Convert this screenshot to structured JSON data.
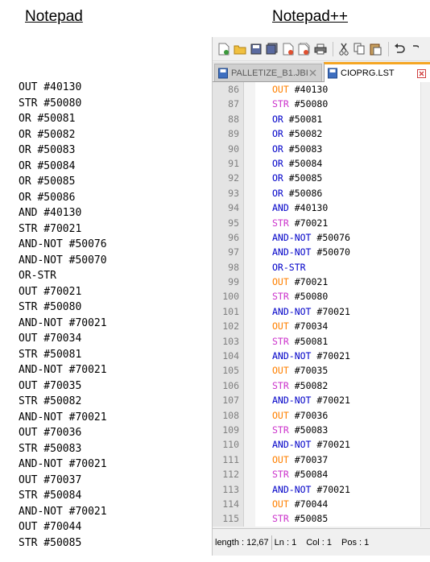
{
  "headings": {
    "notepad": "Notepad",
    "notepadpp": "Notepad++"
  },
  "notepad_lines": [
    "OUT #40130",
    "STR #50080",
    "OR #50081",
    "OR #50082",
    "OR #50083",
    "OR #50084",
    "OR #50085",
    "OR #50086",
    "AND #40130",
    "STR #70021",
    "AND-NOT #50076",
    "AND-NOT #50070",
    "OR-STR",
    "OUT #70021",
    "STR #50080",
    "AND-NOT #70021",
    "OUT #70034",
    "STR #50081",
    "AND-NOT #70021",
    "OUT #70035",
    "STR #50082",
    "AND-NOT #70021",
    "OUT #70036",
    "STR #50083",
    "AND-NOT #70021",
    "OUT #70037",
    "STR #50084",
    "AND-NOT #70021",
    "OUT #70044",
    "STR #50085"
  ],
  "tabs": [
    {
      "label": "PALLETIZE_B1.JBI",
      "active": false
    },
    {
      "label": "CIOPRG.LST",
      "active": true
    }
  ],
  "colors": {
    "OUT": "#ff8000",
    "STR": "#cc33cc",
    "OR": "#0000c8",
    "AND": "#0000c8",
    "AND-NOT": "#0000c8",
    "OR-STR": "#0000c8",
    "tab_accent": "#f5a623"
  },
  "editor_lines": [
    {
      "n": "86",
      "op": "OUT",
      "arg": "#40130"
    },
    {
      "n": "87",
      "op": "STR",
      "arg": "#50080"
    },
    {
      "n": "88",
      "op": "OR",
      "arg": "#50081"
    },
    {
      "n": "89",
      "op": "OR",
      "arg": "#50082"
    },
    {
      "n": "90",
      "op": "OR",
      "arg": "#50083"
    },
    {
      "n": "91",
      "op": "OR",
      "arg": "#50084"
    },
    {
      "n": "92",
      "op": "OR",
      "arg": "#50085"
    },
    {
      "n": "93",
      "op": "OR",
      "arg": "#50086"
    },
    {
      "n": "94",
      "op": "AND",
      "arg": "#40130"
    },
    {
      "n": "95",
      "op": "STR",
      "arg": "#70021"
    },
    {
      "n": "96",
      "op": "AND-NOT",
      "arg": "#50076"
    },
    {
      "n": "97",
      "op": "AND-NOT",
      "arg": "#50070"
    },
    {
      "n": "98",
      "op": "OR-STR",
      "arg": ""
    },
    {
      "n": "99",
      "op": "OUT",
      "arg": "#70021"
    },
    {
      "n": "100",
      "op": "STR",
      "arg": "#50080"
    },
    {
      "n": "101",
      "op": "AND-NOT",
      "arg": "#70021"
    },
    {
      "n": "102",
      "op": "OUT",
      "arg": "#70034"
    },
    {
      "n": "103",
      "op": "STR",
      "arg": "#50081"
    },
    {
      "n": "104",
      "op": "AND-NOT",
      "arg": "#70021"
    },
    {
      "n": "105",
      "op": "OUT",
      "arg": "#70035"
    },
    {
      "n": "106",
      "op": "STR",
      "arg": "#50082"
    },
    {
      "n": "107",
      "op": "AND-NOT",
      "arg": "#70021"
    },
    {
      "n": "108",
      "op": "OUT",
      "arg": "#70036"
    },
    {
      "n": "109",
      "op": "STR",
      "arg": "#50083"
    },
    {
      "n": "110",
      "op": "AND-NOT",
      "arg": "#70021"
    },
    {
      "n": "111",
      "op": "OUT",
      "arg": "#70037"
    },
    {
      "n": "112",
      "op": "STR",
      "arg": "#50084"
    },
    {
      "n": "113",
      "op": "AND-NOT",
      "arg": "#70021"
    },
    {
      "n": "114",
      "op": "OUT",
      "arg": "#70044"
    },
    {
      "n": "115",
      "op": "STR",
      "arg": "#50085"
    }
  ],
  "statusbar": {
    "length": "length : 12,67",
    "ln": "Ln : 1",
    "col": "Col : 1",
    "pos": "Pos : 1"
  },
  "toolbar_icons": [
    "new-file-icon",
    "open-file-icon",
    "save-icon",
    "save-all-icon",
    "close-icon",
    "close-all-icon",
    "print-icon",
    "cut-icon",
    "copy-icon",
    "paste-icon",
    "undo-icon"
  ]
}
